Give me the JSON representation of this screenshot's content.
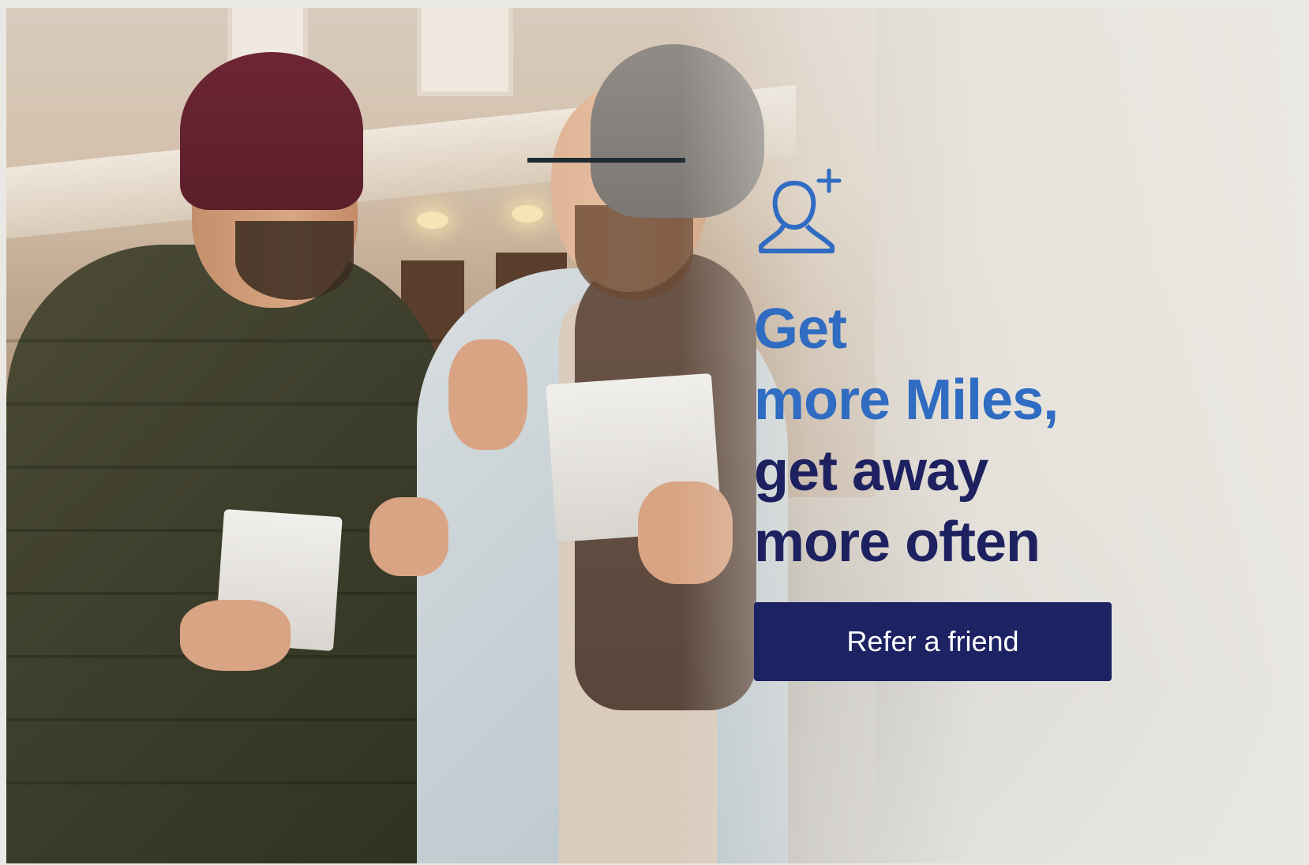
{
  "promo": {
    "headline": {
      "line1": "Get",
      "line2": "more Miles,",
      "line3": "get away",
      "line4": "more often"
    },
    "cta_label": "Refer a friend",
    "icon": "add-user-icon"
  },
  "colors": {
    "accent_blue": "#2f6cc2",
    "navy": "#1e2160",
    "button_bg": "#1d2262",
    "button_text": "#ffffff"
  }
}
